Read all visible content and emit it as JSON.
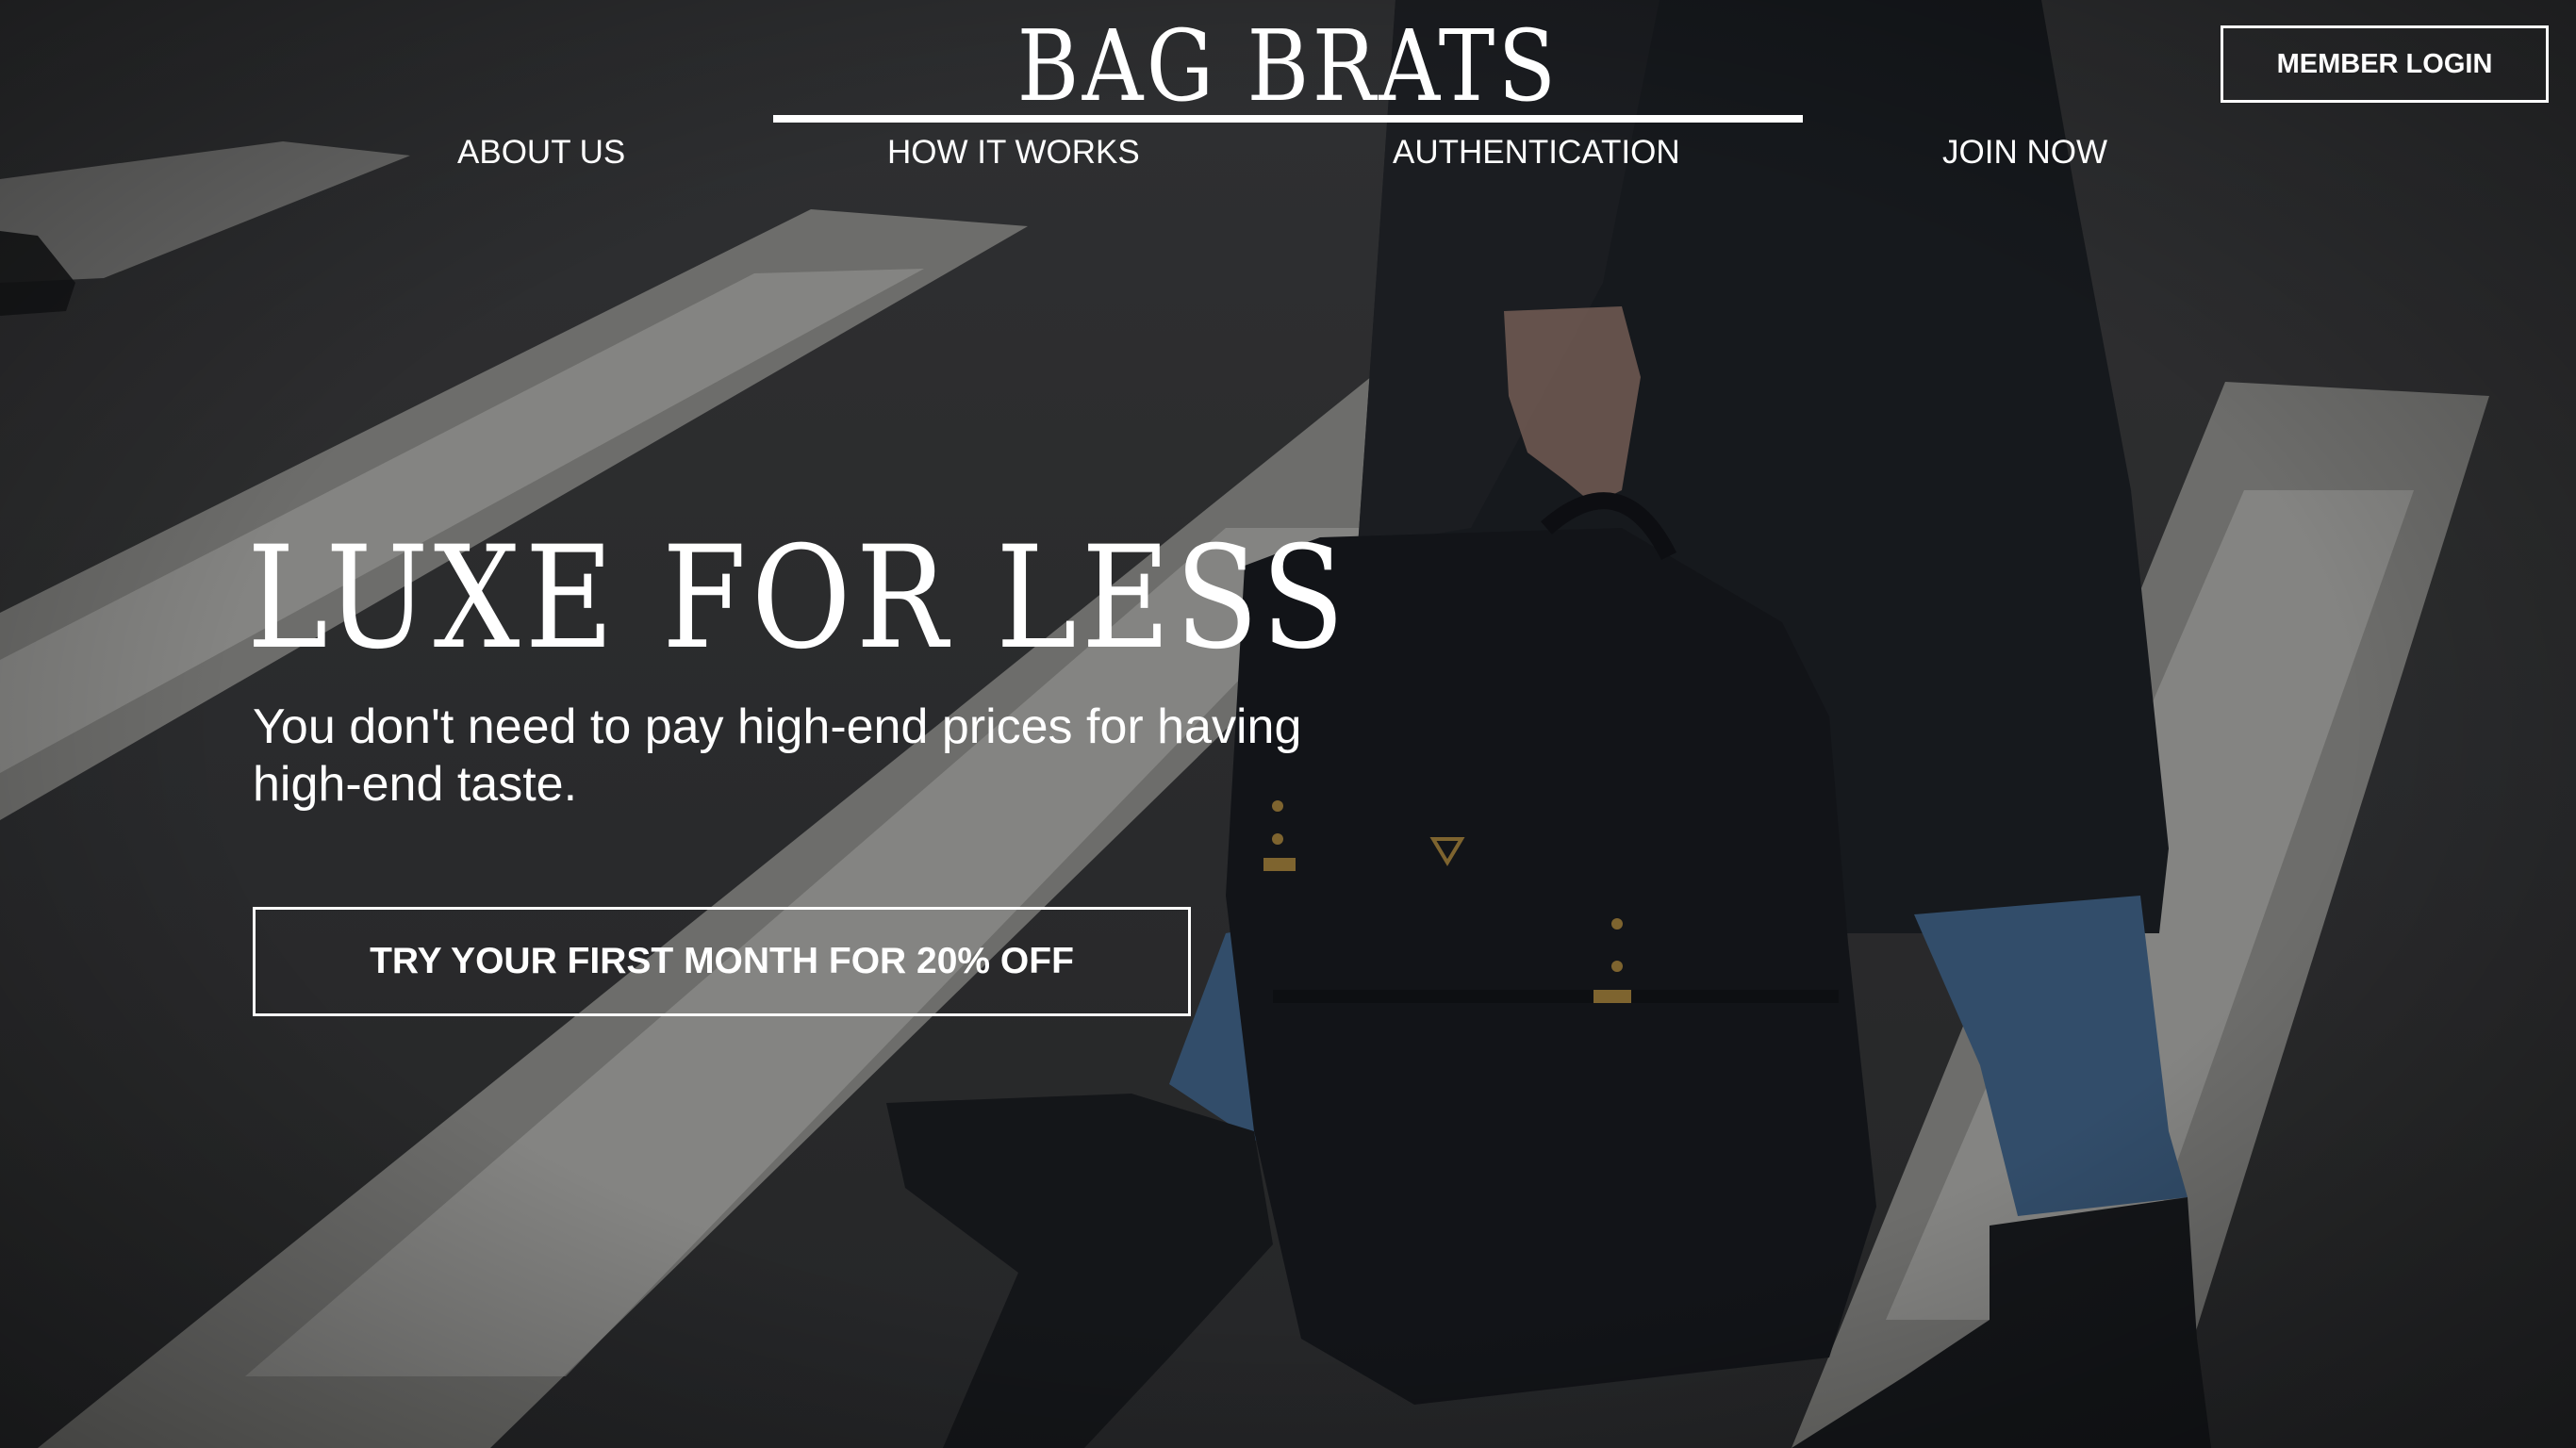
{
  "header": {
    "brand": "BAG BRATS",
    "member_login_label": "MEMBER LOGIN"
  },
  "nav": {
    "items": [
      {
        "label": "ABOUT US"
      },
      {
        "label": "HOW IT WORKS"
      },
      {
        "label": "AUTHENTICATION"
      },
      {
        "label": "JOIN NOW"
      }
    ]
  },
  "hero": {
    "title": "LUXE FOR LESS",
    "subtitle": "You don't need to pay high-end prices for having high-end taste.",
    "cta_label": "TRY YOUR FIRST MONTH FOR 20% OFF",
    "background_image": "person-holding-black-backpack-on-crosswalk"
  },
  "colors": {
    "text": "#ffffff",
    "asphalt": "#2f3033",
    "crosswalk_stripe": "#9a9a97",
    "coat": "#1c1f24",
    "jeans": "#3d5f82",
    "backpack": "#16191e"
  }
}
